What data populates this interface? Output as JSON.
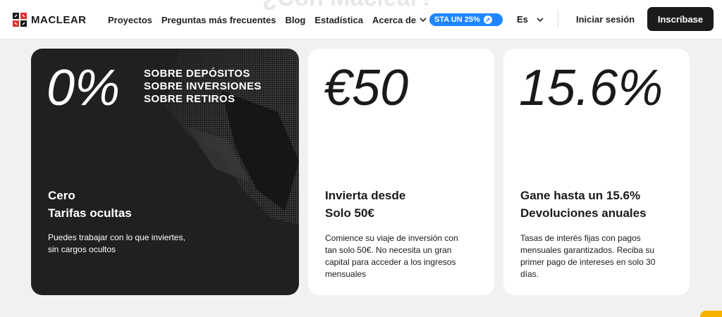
{
  "nav": {
    "logo_text": "MACLEAR",
    "links": [
      {
        "label": "Proyectos"
      },
      {
        "label": "Preguntas más frecuentes"
      },
      {
        "label": "Blog"
      },
      {
        "label": "Estadística"
      },
      {
        "label": "Acerca de"
      }
    ],
    "promo_label": "STA UN 25%",
    "language": "Es",
    "login_label": "Iniciar sesión",
    "signup_label": "Inscríbase"
  },
  "background_heading": "¿Con Maclear?",
  "cards": [
    {
      "big": "0%",
      "fees": [
        "SOBRE DEPÓSITOS",
        "SOBRE INVERSIONES",
        "SOBRE RETIROS"
      ],
      "title_lines": [
        "Cero",
        "Tarifas ocultas"
      ],
      "desc": "Puedes trabajar con lo que inviertes, sin cargos ocultos"
    },
    {
      "big": "€50",
      "title_lines": [
        "Invierta desde",
        "Solo 50€"
      ],
      "desc": "Comience su viaje de inversión con tan solo 50€. No necesita un gran capital para acceder a los ingresos mensuales"
    },
    {
      "big": "15.6%",
      "title_lines": [
        "Gane hasta un 15.6%",
        "Devoluciones anuales"
      ],
      "desc": "Tasas de interés fijas con pagos mensuales garantizados. Reciba su primer pago de intereses en solo 30 días."
    }
  ],
  "colors": {
    "dark_card": "#1f2022",
    "signup_bg": "#1b1b1b",
    "promo_bg": "#1f86ff",
    "logo_red": "#e0312b"
  }
}
